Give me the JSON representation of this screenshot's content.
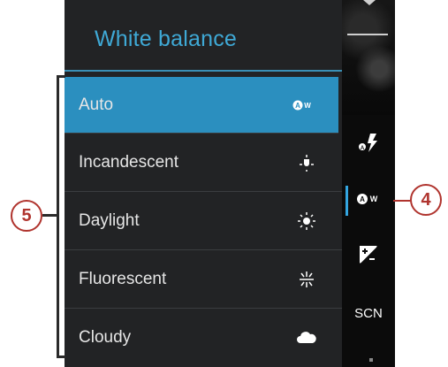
{
  "menu": {
    "title": "White balance",
    "items": [
      {
        "label": "Auto",
        "icon": "awb-auto-icon",
        "selected": true
      },
      {
        "label": "Incandescent",
        "icon": "incandescent-icon",
        "selected": false
      },
      {
        "label": "Daylight",
        "icon": "daylight-icon",
        "selected": false
      },
      {
        "label": "Fluorescent",
        "icon": "fluorescent-icon",
        "selected": false
      },
      {
        "label": "Cloudy",
        "icon": "cloudy-icon",
        "selected": false
      }
    ]
  },
  "side_controls": {
    "flash_icon": "flash-auto-icon",
    "white_balance_icon": "awb-icon",
    "exposure_icon": "exposure-icon",
    "scene_label": "SCN"
  },
  "callouts": {
    "menu_callout": "5",
    "wb_callout": "4"
  },
  "colors": {
    "accent": "#2b8fbf",
    "title": "#3fa9d6",
    "callout": "#b0342e"
  }
}
